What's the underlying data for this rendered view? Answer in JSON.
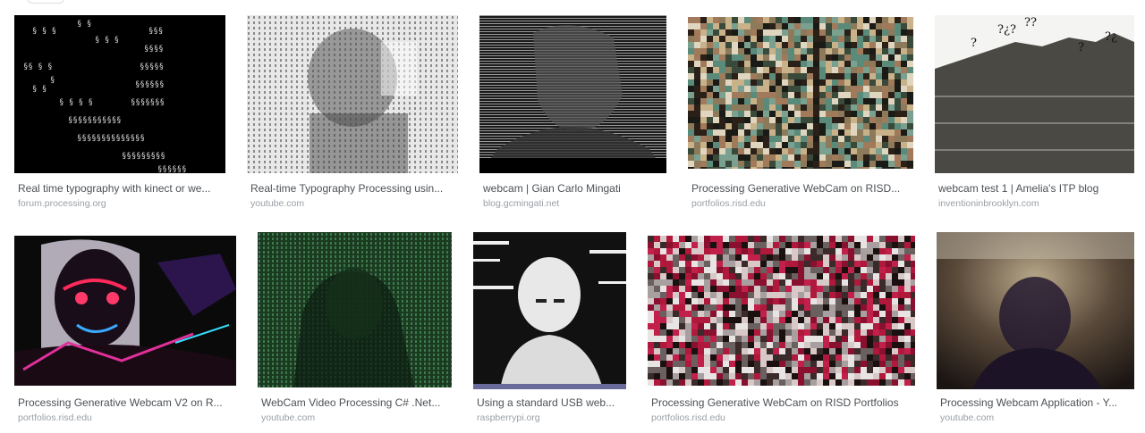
{
  "results": [
    {
      "title": "Real time typography with kinect or we...",
      "source": "forum.processing.org"
    },
    {
      "title": "Real-time Typography Processing usin...",
      "source": "youtube.com"
    },
    {
      "title": "webcam | Gian Carlo Mingati",
      "source": "blog.gcmingati.net"
    },
    {
      "title": "Processing Generative WebCam on RISD...",
      "source": "portfolios.risd.edu"
    },
    {
      "title": "webcam test 1 | Amelia's ITP blog",
      "source": "inventioninbrooklyn.com"
    },
    {
      "title": "Processing Generative Webcam V2 on R...",
      "source": "portfolios.risd.edu"
    },
    {
      "title": "WebCam Video Processing C# .Net...",
      "source": "youtube.com"
    },
    {
      "title": "Using a standard USB web...",
      "source": "raspberrypi.org"
    },
    {
      "title": "Processing Generative WebCam on RISD Portfolios",
      "source": "portfolios.risd.edu"
    },
    {
      "title": "Processing Webcam Application - Y...",
      "source": "youtube.com"
    }
  ],
  "colors": {
    "caption": "#4d5156",
    "source": "#9aa0a6"
  }
}
